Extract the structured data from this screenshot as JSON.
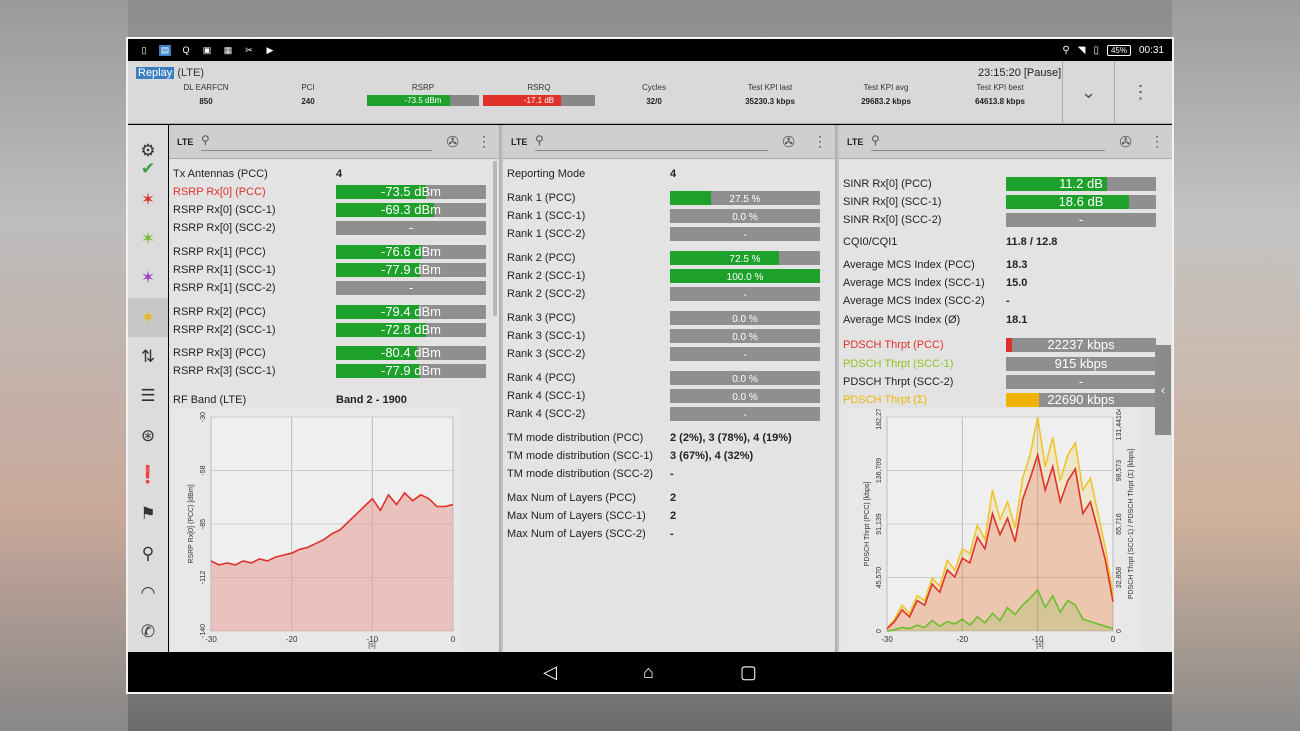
{
  "status_bar": {
    "battery": "45%",
    "time": "00:31"
  },
  "header": {
    "replay_label": "Replay",
    "tech": "(LTE)",
    "timestamp": "23:15:20 [Pause]",
    "kpis": [
      {
        "label": "DL EARFCN",
        "value": "850"
      },
      {
        "label": "PCI",
        "value": "240"
      },
      {
        "label": "RSRP",
        "value": "-73.5 dBm",
        "level": 0.6
      },
      {
        "label": "RSRQ",
        "value": "-17.1 dB",
        "level": 0.55
      },
      {
        "label": "Cycles",
        "value": "32/0"
      },
      {
        "label": "Test KPI last",
        "value": "35230.3 kbps"
      },
      {
        "label": "Test KPI avg",
        "value": "29683.2 kbps"
      },
      {
        "label": "Test KPI best",
        "value": "64613.8 kbps"
      }
    ]
  },
  "colors": {
    "green": "#1da12b",
    "red": "#e0302a",
    "yellow": "#f0b400",
    "accent": "#3a7fc2"
  },
  "panel_toolbar": {
    "tech": "LTE"
  },
  "panel1": {
    "tx_antennas_label": "Tx Antennas (PCC)",
    "tx_antennas_value": "4",
    "rsrp_rows": [
      {
        "label": "RSRP Rx[0] (PCC)",
        "value": "-73.5 dBm",
        "level": 0.6,
        "highlight": "red"
      },
      {
        "label": "RSRP Rx[0] (SCC-1)",
        "value": "-69.3 dBm",
        "level": 0.65
      },
      {
        "label": "RSRP Rx[0] (SCC-2)",
        "value": "-",
        "level": 0
      },
      {
        "label": "RSRP Rx[1] (PCC)",
        "value": "-76.6 dBm",
        "level": 0.57
      },
      {
        "label": "RSRP Rx[1] (SCC-1)",
        "value": "-77.9 dBm",
        "level": 0.56
      },
      {
        "label": "RSRP Rx[1] (SCC-2)",
        "value": "-",
        "level": 0
      },
      {
        "label": "RSRP Rx[2] (PCC)",
        "value": "-79.4 dBm",
        "level": 0.55
      },
      {
        "label": "RSRP Rx[2] (SCC-1)",
        "value": "-72.8 dBm",
        "level": 0.6
      },
      {
        "label": "RSRP Rx[3] (PCC)",
        "value": "-80.4 dBm",
        "level": 0.54
      },
      {
        "label": "RSRP Rx[3] (SCC-1)",
        "value": "-77.9 dBm",
        "level": 0.56
      }
    ],
    "rf_band_label": "RF Band (LTE)",
    "rf_band_value": "Band 2 - 1900"
  },
  "panel2": {
    "reporting_mode_label": "Reporting Mode",
    "reporting_mode_value": "4",
    "ranks": [
      {
        "label": "Rank 1 (PCC)",
        "value": "27.5 %",
        "level": 0.275
      },
      {
        "label": "Rank 1 (SCC-1)",
        "value": "0.0 %",
        "level": 0
      },
      {
        "label": "Rank 1 (SCC-2)",
        "value": "-",
        "level": 0
      },
      {
        "label": "Rank 2 (PCC)",
        "value": "72.5 %",
        "level": 0.725
      },
      {
        "label": "Rank 2 (SCC-1)",
        "value": "100.0 %",
        "level": 1.0
      },
      {
        "label": "Rank 2 (SCC-2)",
        "value": "-",
        "level": 0
      },
      {
        "label": "Rank 3 (PCC)",
        "value": "0.0 %",
        "level": 0
      },
      {
        "label": "Rank 3 (SCC-1)",
        "value": "0.0 %",
        "level": 0
      },
      {
        "label": "Rank 3 (SCC-2)",
        "value": "-",
        "level": 0
      },
      {
        "label": "Rank 4 (PCC)",
        "value": "0.0 %",
        "level": 0
      },
      {
        "label": "Rank 4 (SCC-1)",
        "value": "0.0 %",
        "level": 0
      },
      {
        "label": "Rank 4 (SCC-2)",
        "value": "-",
        "level": 0
      }
    ],
    "tm_rows": [
      {
        "label": "TM mode distribution (PCC)",
        "value": "2 (2%), 3 (78%), 4 (19%)"
      },
      {
        "label": "TM mode distribution (SCC-1)",
        "value": "3 (67%), 4 (32%)"
      },
      {
        "label": "TM mode distribution (SCC-2)",
        "value": "-"
      }
    ],
    "layer_rows": [
      {
        "label": "Max Num of Layers (PCC)",
        "value": "2"
      },
      {
        "label": "Max Num of Layers (SCC-1)",
        "value": "2"
      },
      {
        "label": "Max Num of Layers (SCC-2)",
        "value": "-"
      }
    ]
  },
  "panel3": {
    "sinr_rows": [
      {
        "label": "SINR Rx[0] (PCC)",
        "value": "11.2 dB",
        "level": 0.67
      },
      {
        "label": "SINR Rx[0] (SCC-1)",
        "value": "18.6 dB",
        "level": 0.82
      },
      {
        "label": "SINR Rx[0] (SCC-2)",
        "value": "-",
        "level": 0
      }
    ],
    "stat_rows": [
      {
        "label": "CQI0/CQI1",
        "value": "11.8 / 12.8"
      },
      {
        "label": "Average MCS Index (PCC)",
        "value": "18.3"
      },
      {
        "label": "Average MCS Index (SCC-1)",
        "value": "15.0"
      },
      {
        "label": "Average MCS Index (SCC-2)",
        "value": "-"
      },
      {
        "label": "Average MCS Index (Ø)",
        "value": "18.1"
      }
    ],
    "thrpt_rows": [
      {
        "label": "PDSCH Thrpt (PCC)",
        "value": "22237 kbps",
        "level": 0.04,
        "color": "red"
      },
      {
        "label": "PDSCH Thrpt (SCC-1)",
        "value": "915 kbps",
        "level": 0,
        "color": "green"
      },
      {
        "label": "PDSCH Thrpt (SCC-2)",
        "value": "-",
        "level": 0,
        "color": "black"
      },
      {
        "label": "PDSCH Thrpt (Σ)",
        "value": "22690 kbps",
        "level": 0.22,
        "color": "yellow"
      }
    ]
  },
  "chart_data": [
    {
      "type": "area",
      "ylabel": "RSRP Rx[0] (PCC) [dBm]",
      "xlabel": "[s]",
      "x_ticks": [
        "-30",
        "-20",
        "-10",
        "0"
      ],
      "y_ticks": [
        "-30",
        "-58",
        "-85",
        "-112",
        "-140"
      ],
      "xlim": [
        -30,
        0
      ],
      "ylim": [
        -140,
        -30
      ],
      "series": [
        {
          "color": "#e0302a",
          "x": [
            -30,
            -29,
            -28,
            -27,
            -26,
            -25,
            -24,
            -23,
            -22,
            -21,
            -20,
            -19,
            -18,
            -17,
            -16,
            -15,
            -14,
            -13,
            -12,
            -11,
            -10,
            -9,
            -8,
            -7,
            -6,
            -5,
            -4,
            -3,
            -2,
            -1,
            0
          ],
          "y": [
            -104,
            -106,
            -105,
            -106,
            -104,
            -105,
            -103,
            -104,
            -102,
            -101,
            -100,
            -98,
            -97,
            -95,
            -93,
            -90,
            -88,
            -84,
            -80,
            -76,
            -72,
            -78,
            -70,
            -75,
            -69,
            -73,
            -70,
            -72,
            -76,
            -76,
            -75
          ]
        }
      ]
    },
    {
      "type": "line",
      "ylabel": "PDSCH Thrpt (PCC) [kbps]",
      "ylabel_right": "PDSCH Thrpt (SCC-1) / PDSCH Thrpt (Σ) [kbps]",
      "xlabel": "[s]",
      "x_ticks": [
        "-30",
        "-20",
        "-10",
        "0"
      ],
      "y_ticks_left": [
        "182,278",
        "136,709",
        "91,139",
        "45,570",
        "0"
      ],
      "y_ticks_right": [
        "131,44164,289",
        "98,573",
        "65,716",
        "32,858",
        "0"
      ],
      "xlim": [
        -30,
        0
      ],
      "ylim": [
        0,
        182278
      ],
      "series": [
        {
          "name": "PDSCH Thrpt (Σ)",
          "color": "#f0c42a",
          "x": [
            -30,
            -29,
            -28,
            -27,
            -26,
            -25,
            -24,
            -23,
            -22,
            -21,
            -20,
            -19,
            -18,
            -17,
            -16,
            -15,
            -14,
            -13,
            -12,
            -11,
            -10,
            -9,
            -8,
            -7,
            -6,
            -5,
            -4,
            -3,
            -2,
            -1,
            0
          ],
          "y": [
            2000,
            10000,
            22000,
            15000,
            30000,
            26000,
            45000,
            38000,
            60000,
            52000,
            70000,
            66000,
            90000,
            78000,
            120000,
            95000,
            110000,
            88000,
            130000,
            150000,
            182000,
            140000,
            165000,
            128000,
            150000,
            160000,
            120000,
            130000,
            100000,
            70000,
            30000
          ]
        },
        {
          "name": "PDSCH Thrpt (PCC)",
          "color": "#e0302a",
          "x": [
            -30,
            -29,
            -28,
            -27,
            -26,
            -25,
            -24,
            -23,
            -22,
            -21,
            -20,
            -19,
            -18,
            -17,
            -16,
            -15,
            -14,
            -13,
            -12,
            -11,
            -10,
            -9,
            -8,
            -7,
            -6,
            -5,
            -4,
            -3,
            -2,
            -1,
            0
          ],
          "y": [
            2000,
            8000,
            18000,
            12000,
            26000,
            22000,
            40000,
            33000,
            52000,
            46000,
            62000,
            58000,
            80000,
            70000,
            100000,
            82000,
            96000,
            76000,
            112000,
            130000,
            150000,
            120000,
            140000,
            110000,
            128000,
            138000,
            100000,
            110000,
            86000,
            60000,
            25000
          ]
        },
        {
          "name": "PDSCH Thrpt (SCC-1)",
          "color": "#6bbf2a",
          "x": [
            -30,
            -29,
            -28,
            -27,
            -26,
            -25,
            -24,
            -23,
            -22,
            -21,
            -20,
            -19,
            -18,
            -17,
            -16,
            -15,
            -14,
            -13,
            -12,
            -11,
            -10,
            -9,
            -8,
            -7,
            -6,
            -5,
            -4,
            -3,
            -2,
            -1,
            0
          ],
          "y": [
            0,
            1000,
            3000,
            2000,
            5000,
            3000,
            9000,
            4000,
            8000,
            6000,
            10000,
            5000,
            12000,
            7000,
            15000,
            9000,
            20000,
            14000,
            22000,
            28000,
            35000,
            20000,
            30000,
            16000,
            26000,
            22000,
            10000,
            8000,
            6000,
            4000,
            2000
          ]
        }
      ]
    }
  ]
}
